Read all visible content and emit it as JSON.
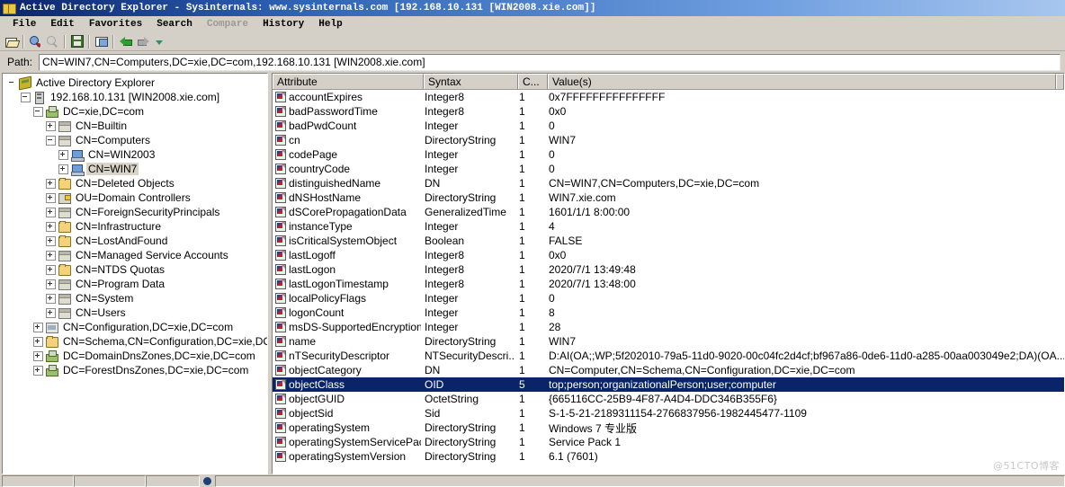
{
  "window": {
    "title": "Active Directory Explorer - Sysinternals: www.sysinternals.com [192.168.10.131 [WIN2008.xie.com]]",
    "app_icon": "book-icon"
  },
  "menubar": {
    "items": [
      {
        "label": "File",
        "disabled": false
      },
      {
        "label": "Edit",
        "disabled": false
      },
      {
        "label": "Favorites",
        "disabled": false
      },
      {
        "label": "Search",
        "disabled": false
      },
      {
        "label": "Compare",
        "disabled": true
      },
      {
        "label": "History",
        "disabled": false
      },
      {
        "label": "Help",
        "disabled": false
      }
    ]
  },
  "toolbar": {
    "buttons": [
      {
        "name": "open-folder-icon"
      },
      {
        "name": "search-icon"
      },
      {
        "name": "search-again-icon"
      },
      {
        "name": "save-icon"
      },
      {
        "name": "properties-icon"
      },
      {
        "name": "back-arrow-icon"
      },
      {
        "name": "forward-arrow-icon"
      },
      {
        "name": "dropdown-arrow-icon"
      }
    ]
  },
  "pathbar": {
    "label": "Path:",
    "value": "CN=WIN7,CN=Computers,DC=xie,DC=com,192.168.10.131 [WIN2008.xie.com]"
  },
  "tree": {
    "nodes": [
      {
        "label": "Active Directory Explorer",
        "depth": 0,
        "icon": "ade-icon",
        "expander": "none",
        "selected": false
      },
      {
        "label": "192.168.10.131 [WIN2008.xie.com]",
        "depth": 1,
        "icon": "server-icon",
        "expander": "minus",
        "selected": false
      },
      {
        "label": "DC=xie,DC=com",
        "depth": 2,
        "icon": "domain-icon",
        "expander": "minus",
        "selected": false
      },
      {
        "label": "CN=Builtin",
        "depth": 3,
        "icon": "container-icon",
        "expander": "plus",
        "selected": false
      },
      {
        "label": "CN=Computers",
        "depth": 3,
        "icon": "container-icon",
        "expander": "minus",
        "selected": false
      },
      {
        "label": "CN=WIN2003",
        "depth": 4,
        "icon": "computer-icon",
        "expander": "plus",
        "selected": false
      },
      {
        "label": "CN=WIN7",
        "depth": 4,
        "icon": "computer-icon",
        "expander": "plus",
        "selected": true
      },
      {
        "label": "CN=Deleted Objects",
        "depth": 3,
        "icon": "folder-icon",
        "expander": "plus",
        "selected": false
      },
      {
        "label": "OU=Domain Controllers",
        "depth": 3,
        "icon": "ou-icon",
        "expander": "plus",
        "selected": false
      },
      {
        "label": "CN=ForeignSecurityPrincipals",
        "depth": 3,
        "icon": "container-icon",
        "expander": "plus",
        "selected": false
      },
      {
        "label": "CN=Infrastructure",
        "depth": 3,
        "icon": "folder-icon",
        "expander": "plus",
        "selected": false
      },
      {
        "label": "CN=LostAndFound",
        "depth": 3,
        "icon": "folder-icon",
        "expander": "plus",
        "selected": false
      },
      {
        "label": "CN=Managed Service Accounts",
        "depth": 3,
        "icon": "container-icon",
        "expander": "plus",
        "selected": false
      },
      {
        "label": "CN=NTDS Quotas",
        "depth": 3,
        "icon": "folder-icon",
        "expander": "plus",
        "selected": false
      },
      {
        "label": "CN=Program Data",
        "depth": 3,
        "icon": "container-icon",
        "expander": "plus",
        "selected": false
      },
      {
        "label": "CN=System",
        "depth": 3,
        "icon": "container-icon",
        "expander": "plus",
        "selected": false
      },
      {
        "label": "CN=Users",
        "depth": 3,
        "icon": "container-icon",
        "expander": "plus",
        "selected": false
      },
      {
        "label": "CN=Configuration,DC=xie,DC=com",
        "depth": 2,
        "icon": "config-icon",
        "expander": "plus",
        "selected": false
      },
      {
        "label": "CN=Schema,CN=Configuration,DC=xie,DC=com",
        "depth": 2,
        "icon": "folder-icon",
        "expander": "plus",
        "selected": false
      },
      {
        "label": "DC=DomainDnsZones,DC=xie,DC=com",
        "depth": 2,
        "icon": "domain-icon",
        "expander": "plus",
        "selected": false
      },
      {
        "label": "DC=ForestDnsZones,DC=xie,DC=com",
        "depth": 2,
        "icon": "domain-icon",
        "expander": "plus",
        "selected": false
      }
    ]
  },
  "list": {
    "columns": [
      "Attribute",
      "Syntax",
      "C...",
      "Value(s)"
    ],
    "rows": [
      {
        "attribute": "accountExpires",
        "syntax": "Integer8",
        "count": "1",
        "value": "0x7FFFFFFFFFFFFFFF",
        "selected": false
      },
      {
        "attribute": "badPasswordTime",
        "syntax": "Integer8",
        "count": "1",
        "value": "0x0",
        "selected": false
      },
      {
        "attribute": "badPwdCount",
        "syntax": "Integer",
        "count": "1",
        "value": "0",
        "selected": false
      },
      {
        "attribute": "cn",
        "syntax": "DirectoryString",
        "count": "1",
        "value": "WIN7",
        "selected": false
      },
      {
        "attribute": "codePage",
        "syntax": "Integer",
        "count": "1",
        "value": "0",
        "selected": false
      },
      {
        "attribute": "countryCode",
        "syntax": "Integer",
        "count": "1",
        "value": "0",
        "selected": false
      },
      {
        "attribute": "distinguishedName",
        "syntax": "DN",
        "count": "1",
        "value": "CN=WIN7,CN=Computers,DC=xie,DC=com",
        "selected": false
      },
      {
        "attribute": "dNSHostName",
        "syntax": "DirectoryString",
        "count": "1",
        "value": "WIN7.xie.com",
        "selected": false
      },
      {
        "attribute": "dSCorePropagationData",
        "syntax": "GeneralizedTime",
        "count": "1",
        "value": "1601/1/1 8:00:00",
        "selected": false
      },
      {
        "attribute": "instanceType",
        "syntax": "Integer",
        "count": "1",
        "value": "4",
        "selected": false
      },
      {
        "attribute": "isCriticalSystemObject",
        "syntax": "Boolean",
        "count": "1",
        "value": "FALSE",
        "selected": false
      },
      {
        "attribute": "lastLogoff",
        "syntax": "Integer8",
        "count": "1",
        "value": "0x0",
        "selected": false
      },
      {
        "attribute": "lastLogon",
        "syntax": "Integer8",
        "count": "1",
        "value": "2020/7/1 13:49:48",
        "selected": false
      },
      {
        "attribute": "lastLogonTimestamp",
        "syntax": "Integer8",
        "count": "1",
        "value": "2020/7/1 13:48:00",
        "selected": false
      },
      {
        "attribute": "localPolicyFlags",
        "syntax": "Integer",
        "count": "1",
        "value": "0",
        "selected": false
      },
      {
        "attribute": "logonCount",
        "syntax": "Integer",
        "count": "1",
        "value": "8",
        "selected": false
      },
      {
        "attribute": "msDS-SupportedEncryption...",
        "syntax": "Integer",
        "count": "1",
        "value": "28",
        "selected": false
      },
      {
        "attribute": "name",
        "syntax": "DirectoryString",
        "count": "1",
        "value": "WIN7",
        "selected": false
      },
      {
        "attribute": "nTSecurityDescriptor",
        "syntax": "NTSecurityDescri...",
        "count": "1",
        "value": "D:AI(OA;;WP;5f202010-79a5-11d0-9020-00c04fc2d4cf;bf967a86-0de6-11d0-a285-00aa003049e2;DA)(OA...",
        "selected": false
      },
      {
        "attribute": "objectCategory",
        "syntax": "DN",
        "count": "1",
        "value": "CN=Computer,CN=Schema,CN=Configuration,DC=xie,DC=com",
        "selected": false
      },
      {
        "attribute": "objectClass",
        "syntax": "OID",
        "count": "5",
        "value": "top;person;organizationalPerson;user;computer",
        "selected": true
      },
      {
        "attribute": "objectGUID",
        "syntax": "OctetString",
        "count": "1",
        "value": "{665116CC-25B9-4F87-A4D4-DDC346B355F6}",
        "selected": false
      },
      {
        "attribute": "objectSid",
        "syntax": "Sid",
        "count": "1",
        "value": "S-1-5-21-2189311154-2766837956-1982445477-1109",
        "selected": false
      },
      {
        "attribute": "operatingSystem",
        "syntax": "DirectoryString",
        "count": "1",
        "value": "Windows 7 专业版",
        "selected": false
      },
      {
        "attribute": "operatingSystemServicePack",
        "syntax": "DirectoryString",
        "count": "1",
        "value": "Service Pack 1",
        "selected": false
      },
      {
        "attribute": "operatingSystemVersion",
        "syntax": "DirectoryString",
        "count": "1",
        "value": "6.1 (7601)",
        "selected": false
      }
    ]
  },
  "watermark": {
    "text": "@51CTO博客"
  },
  "colors": {
    "selection": "#0a246a",
    "titlebar_start": "#0a246a",
    "chrome": "#d4d0c8"
  }
}
